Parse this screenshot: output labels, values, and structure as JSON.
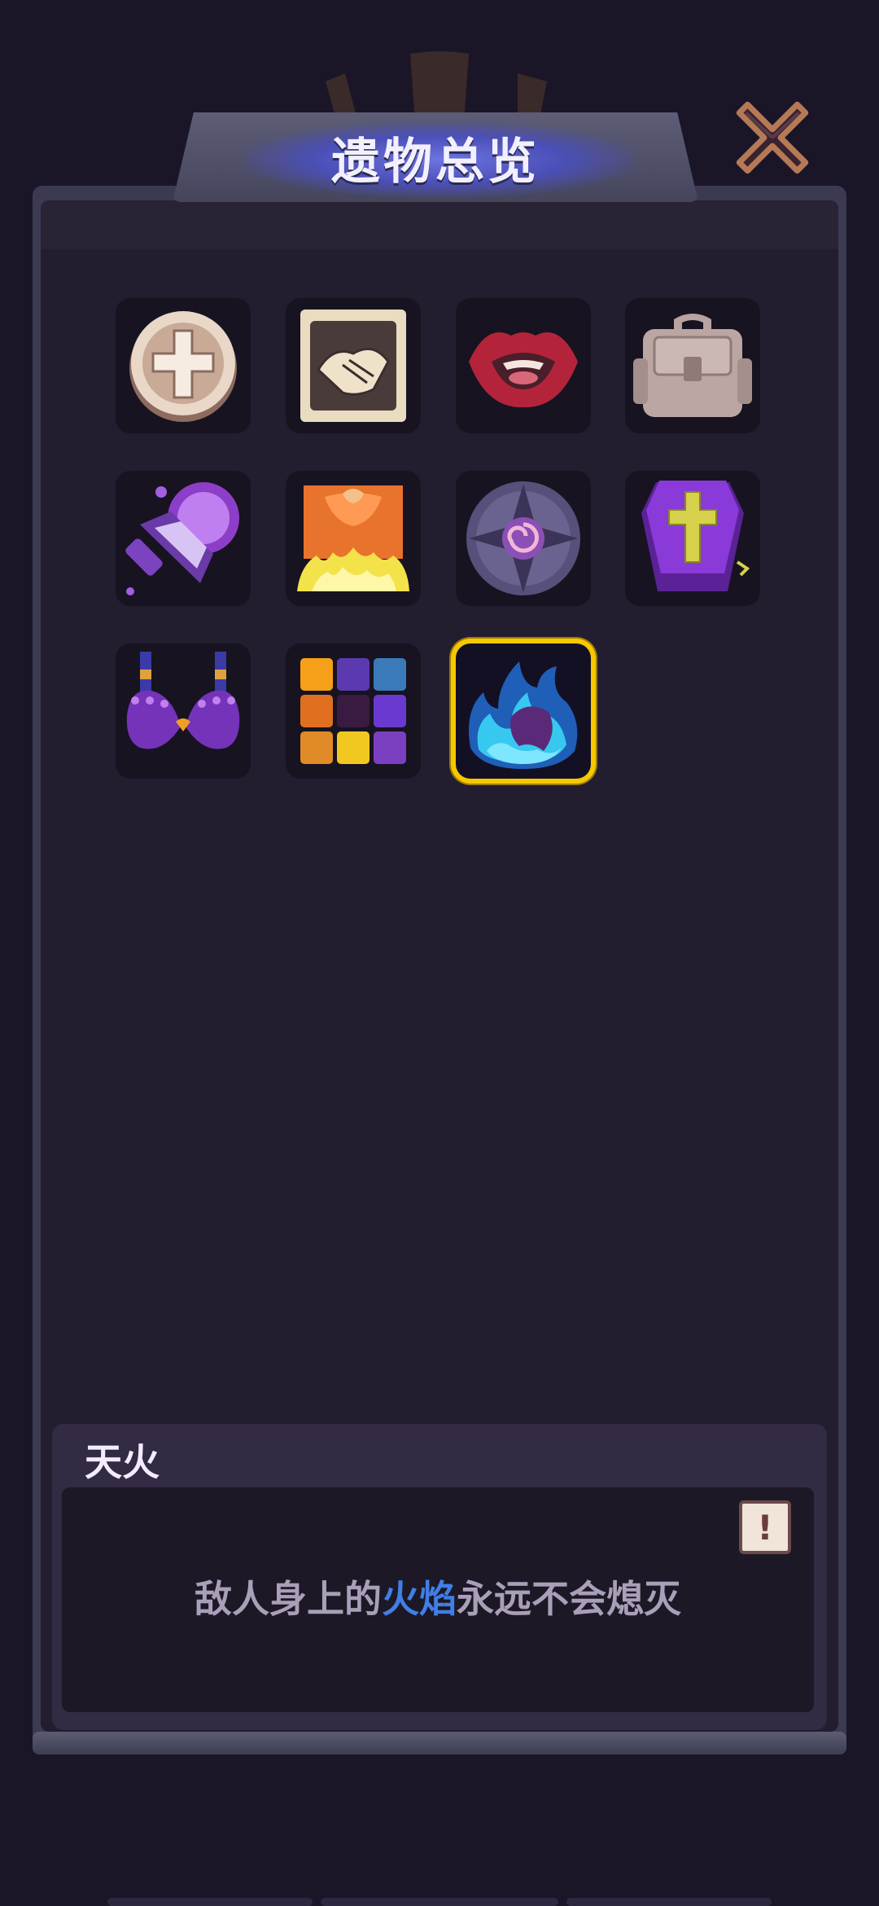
{
  "header": {
    "title": "遗物总览",
    "close_icon": "close-x-icon"
  },
  "relics": [
    {
      "icon": "holy-cross-coin-icon",
      "selected": false
    },
    {
      "icon": "handshake-card-icon",
      "selected": false
    },
    {
      "icon": "red-lips-icon",
      "selected": false
    },
    {
      "icon": "backpack-icon",
      "selected": false
    },
    {
      "icon": "crystal-dagger-icon",
      "selected": false
    },
    {
      "icon": "burning-banner-icon",
      "selected": false
    },
    {
      "icon": "spiral-compass-icon",
      "selected": false
    },
    {
      "icon": "purple-coffin-icon",
      "selected": false
    },
    {
      "icon": "heart-bra-icon",
      "selected": false
    },
    {
      "icon": "color-tiles-icon",
      "selected": false
    },
    {
      "icon": "blue-flame-icon",
      "selected": true
    }
  ],
  "description": {
    "name": "天火",
    "text_before": "敌人身上的",
    "text_highlight": "火焰",
    "text_after": "永远不会熄灭",
    "info_label": "!",
    "highlight_color": "#3f7fe6"
  },
  "colors": {
    "selection": "#f6c800",
    "background": "#1a1628"
  }
}
